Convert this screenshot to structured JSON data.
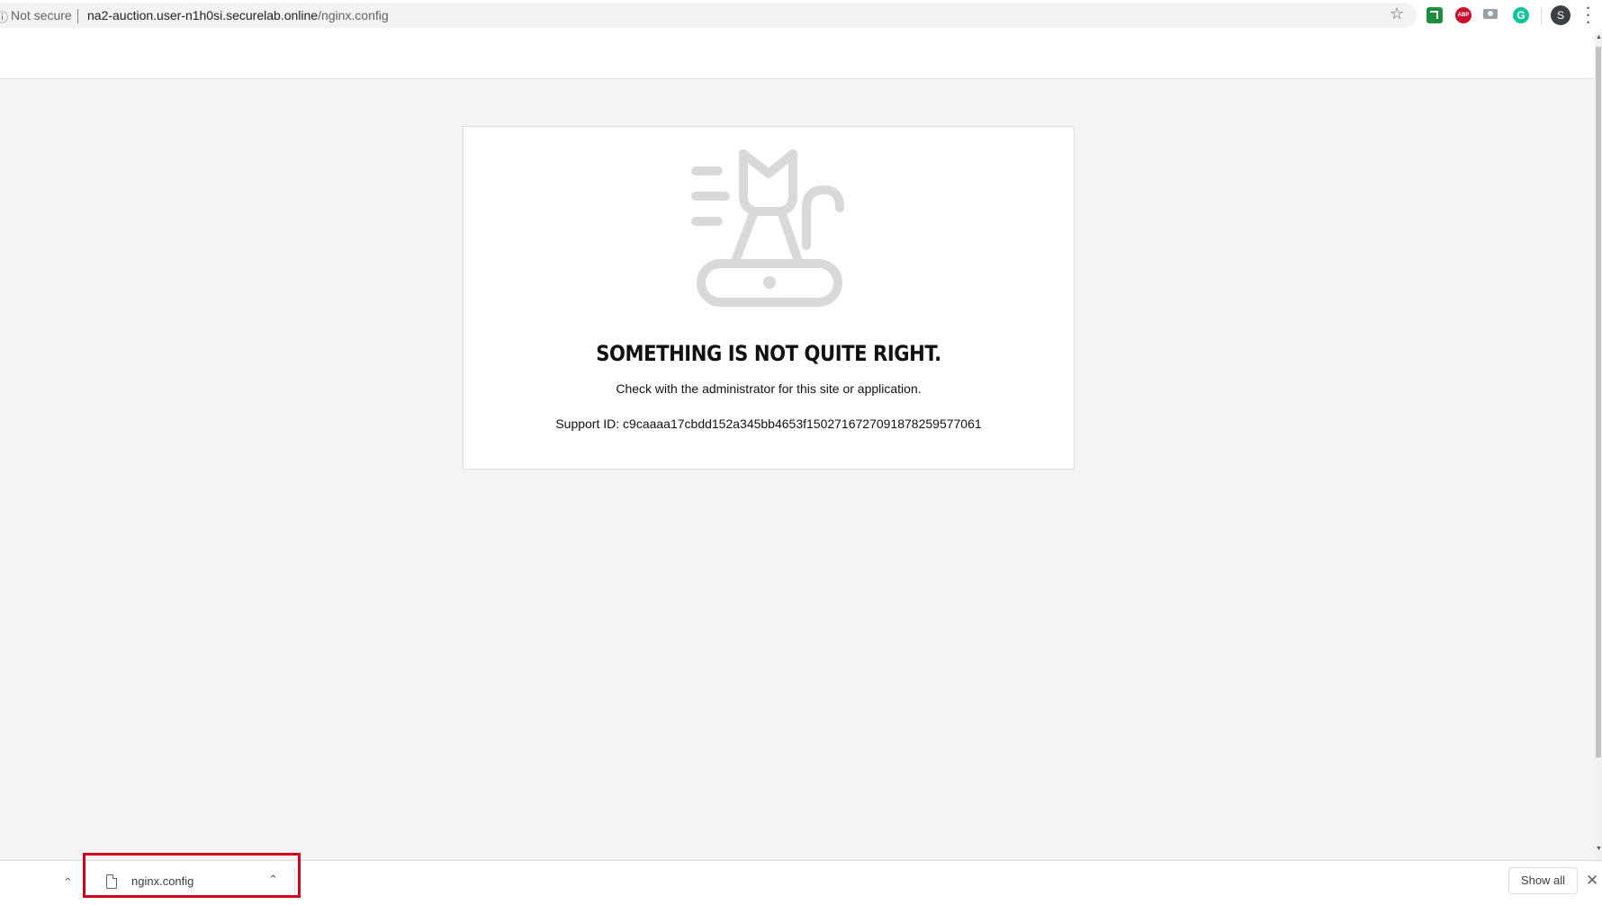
{
  "browser": {
    "security_label": "Not secure",
    "url_host": "na2-auction.user-n1h0si.securelab.online",
    "url_path": "/nginx.config",
    "profile_initial": "S",
    "extensions": [
      "green-extension-icon",
      "adblock-plus-icon",
      "camera-icon",
      "grammarly-icon"
    ],
    "abp_text": "ABP",
    "grammarly_text": "G"
  },
  "error_card": {
    "title": "SOMETHING IS NOT QUITE RIGHT.",
    "message": "Check with the administrator for this site or application.",
    "support_id": "Support ID: c9caaaa17cbdd152a345bb4653f15027167270918782595770​61"
  },
  "download_shelf": {
    "file_name": "nginx.config",
    "show_all_label": "Show all"
  },
  "colors": {
    "highlight": "#d0021b",
    "illustration": "#d9d9d9",
    "page_background": "#f4f4f4"
  }
}
